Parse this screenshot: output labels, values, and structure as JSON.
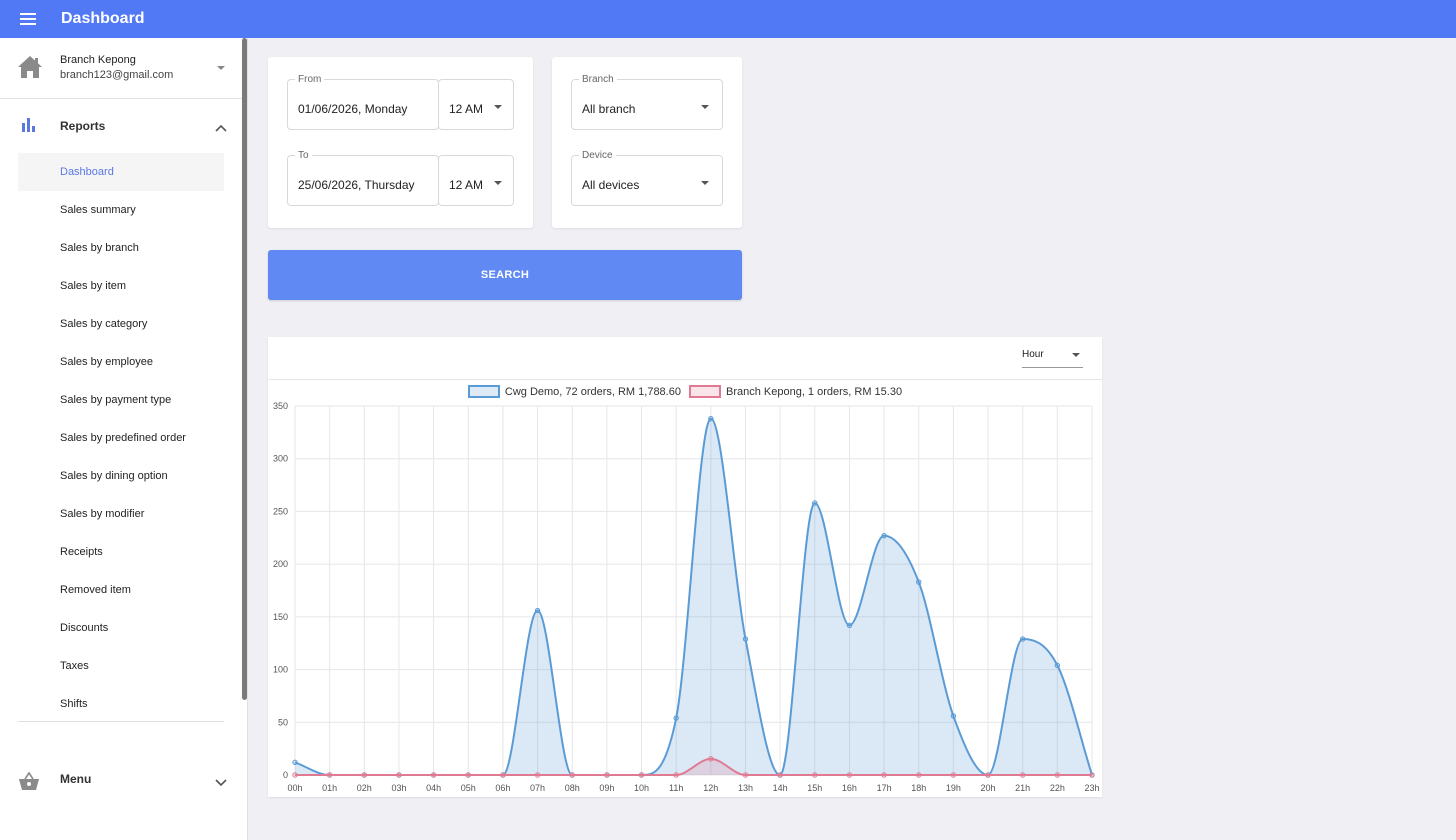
{
  "header": {
    "title": "Dashboard",
    "menu_icon": "hamburger-menu-icon"
  },
  "account": {
    "name": "Branch Kepong",
    "email": "branch123@gmail.com"
  },
  "reports": {
    "label": "Reports",
    "items": [
      {
        "label": "Dashboard",
        "active": true
      },
      {
        "label": "Sales summary"
      },
      {
        "label": "Sales by branch"
      },
      {
        "label": "Sales by item"
      },
      {
        "label": "Sales by category"
      },
      {
        "label": "Sales by employee"
      },
      {
        "label": "Sales by payment type"
      },
      {
        "label": "Sales by predefined order"
      },
      {
        "label": "Sales by dining option"
      },
      {
        "label": "Sales by modifier"
      },
      {
        "label": "Receipts"
      },
      {
        "label": "Removed item"
      },
      {
        "label": "Discounts"
      },
      {
        "label": "Taxes"
      },
      {
        "label": "Shifts"
      }
    ]
  },
  "menu_section": {
    "label": "Menu"
  },
  "filters": {
    "from": {
      "label": "From",
      "date": "01/06/2026, Monday",
      "time": "12 AM"
    },
    "to": {
      "label": "To",
      "date": "25/06/2026, Thursday",
      "time": "12 AM"
    },
    "branch": {
      "label": "Branch",
      "value": "All branch"
    },
    "device": {
      "label": "Device",
      "value": "All devices"
    },
    "search_label": "SEARCH"
  },
  "chart_controls": {
    "interval": "Hour"
  },
  "colors": {
    "accent": "#5178f5",
    "series1": "#5b9bd5",
    "series2": "#e07a93"
  },
  "chart_data": {
    "type": "line",
    "categories": [
      "00h",
      "01h",
      "02h",
      "03h",
      "04h",
      "05h",
      "06h",
      "07h",
      "08h",
      "09h",
      "10h",
      "11h",
      "12h",
      "13h",
      "14h",
      "15h",
      "16h",
      "17h",
      "18h",
      "19h",
      "20h",
      "21h",
      "22h",
      "23h"
    ],
    "series": [
      {
        "name": "Cwg Demo, 72 orders, RM 1,788.60",
        "values": [
          12,
          0,
          0,
          0,
          0,
          0,
          0,
          156,
          0,
          0,
          0,
          54,
          338,
          129,
          0,
          258,
          142,
          227,
          183,
          56,
          0,
          129,
          104,
          0
        ],
        "color": "#5b9bd5",
        "fill": true
      },
      {
        "name": "Branch Kepong, 1 orders, RM 15.30",
        "values": [
          0,
          0,
          0,
          0,
          0,
          0,
          0,
          0,
          0,
          0,
          0,
          0,
          15.3,
          0,
          0,
          0,
          0,
          0,
          0,
          0,
          0,
          0,
          0,
          0
        ],
        "color": "#e07a93",
        "fill": true
      }
    ],
    "ylim": [
      0,
      350
    ],
    "yticks": [
      0,
      50,
      100,
      150,
      200,
      250,
      300,
      350
    ],
    "grid": true,
    "legend": "top-center"
  }
}
